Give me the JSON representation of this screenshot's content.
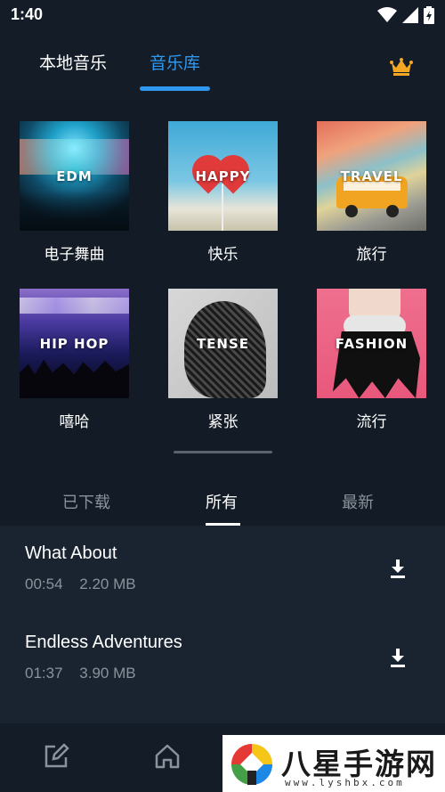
{
  "status": {
    "time": "1:40"
  },
  "top_tabs": {
    "local": "本地音乐",
    "library": "音乐库"
  },
  "genres": [
    {
      "label": "EDM",
      "caption": "电子舞曲"
    },
    {
      "label": "HAPPY",
      "caption": "快乐"
    },
    {
      "label": "TRAVEL",
      "caption": "旅行"
    },
    {
      "label": "HIP HOP",
      "caption": "嘻哈"
    },
    {
      "label": "TENSE",
      "caption": "紧张"
    },
    {
      "label": "FASHION",
      "caption": "流行"
    }
  ],
  "sub_tabs": {
    "downloaded": "已下载",
    "all": "所有",
    "newest": "最新"
  },
  "tracks": [
    {
      "title": "What About",
      "duration": "00:54",
      "size": "2.20 MB"
    },
    {
      "title": "Endless Adventures",
      "duration": "01:37",
      "size": "3.90 MB"
    }
  ],
  "watermark": {
    "text": "八星手游网",
    "url": "www.lyshbx.com"
  },
  "colors": {
    "accent": "#2f98f0",
    "background": "#131c26",
    "crown": "#f5a623"
  },
  "icons": [
    "wifi-icon",
    "signal-icon",
    "battery-icon",
    "crown-icon",
    "download-icon",
    "edit-icon",
    "home-icon"
  ]
}
